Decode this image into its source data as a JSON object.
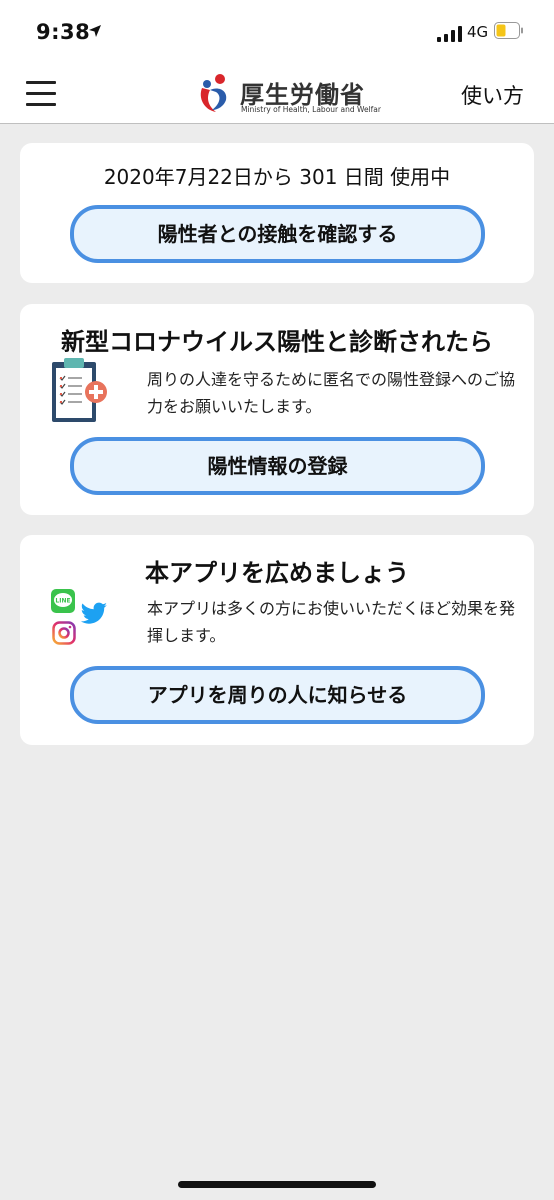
{
  "status": {
    "time": "9:38",
    "network": "4G"
  },
  "header": {
    "logo_title": "厚生労働省",
    "logo_subtitle": "Ministry of Health, Labour and Welfar",
    "howto_label": "使い方"
  },
  "usage_card": {
    "usage_text": "2020年7月22日から 301 日間 使用中",
    "button_label": "陽性者との接触を確認する"
  },
  "positive_card": {
    "title": "新型コロナウイルス陽性と診断されたら",
    "description": "周りの人達を守るために匿名での陽性登録へのご協力をお願いいたします。",
    "button_label": "陽性情報の登録"
  },
  "share_card": {
    "title": "本アプリを広めましょう",
    "description": "本アプリは多くの方にお使いいただくほど効果を発揮します。",
    "button_label": "アプリを周りの人に知らせる",
    "line_icon_text": "LINE"
  },
  "colors": {
    "accent": "#4a90e2",
    "button_bg": "#e8f3fd",
    "page_bg": "#ececec"
  }
}
